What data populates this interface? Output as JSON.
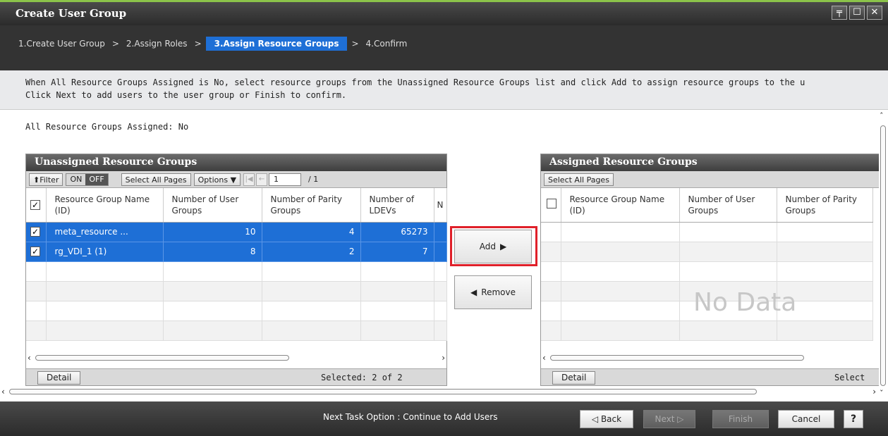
{
  "window": {
    "title": "Create User Group"
  },
  "wizard_steps": [
    {
      "label": "1.Create User Group"
    },
    {
      "label": "2.Assign Roles"
    },
    {
      "label": "3.Assign Resource Groups"
    },
    {
      "label": "4.Confirm"
    }
  ],
  "step_separator": ">",
  "instructions": {
    "line1": "When All Resource Groups Assigned is No, select resource groups from the Unassigned Resource Groups list and click Add to assign resource groups to the u",
    "line2": "Click Next to add users to the user group or Finish to confirm."
  },
  "all_assigned": {
    "label": "All Resource Groups Assigned:",
    "value": "No"
  },
  "unassigned": {
    "title": "Unassigned Resource Groups",
    "filter_label": "Filter",
    "toggle_on": "ON",
    "toggle_off": "OFF",
    "select_all": "Select All Pages",
    "options": "Options",
    "page_value": "1",
    "page_total": "/ 1",
    "columns": [
      "Resource Group Name (ID)",
      "Number of User Groups",
      "Number of Parity Groups",
      "Number of LDEVs",
      "N"
    ],
    "rows": [
      {
        "name": "meta_resource ...",
        "user_groups": "10",
        "parity_groups": "4",
        "ldevs": "65273"
      },
      {
        "name": "rg_VDI_1 (1)",
        "user_groups": "8",
        "parity_groups": "2",
        "ldevs": "7"
      }
    ],
    "detail": "Detail",
    "selected": "Selected: 2  of 2"
  },
  "assigned": {
    "title": "Assigned Resource Groups",
    "select_all": "Select All Pages",
    "columns": [
      "Resource Group Name (ID)",
      "Number of User Groups",
      "Number of Parity Groups"
    ],
    "empty_text": "No Data",
    "detail": "Detail",
    "selected": "Select"
  },
  "buttons": {
    "add": "Add",
    "remove": "Remove"
  },
  "footer": {
    "next_task": "Next Task Option : Continue to Add Users",
    "back": "Back",
    "next": "Next",
    "finish": "Finish",
    "cancel": "Cancel",
    "help": "?"
  },
  "colors": {
    "accent": "#1e6fd6",
    "highlight_box": "#e0202a",
    "title_bar": "#333333"
  }
}
